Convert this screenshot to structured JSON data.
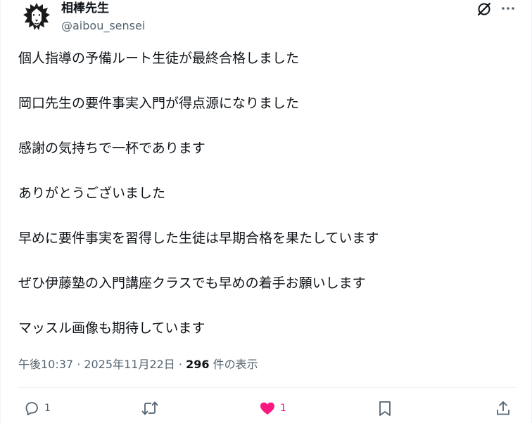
{
  "author": {
    "display_name": "相棒先生",
    "handle": "@aibou_sensei"
  },
  "tweet": {
    "lines": [
      "個人指導の予備ルート生徒が最終合格しました",
      "岡口先生の要件事実入門が得点源になりました",
      "感謝の気持ちで一杯であります",
      "ありがとうございました",
      "早めに要件事実を習得した生徒は早期合格を果たしています",
      "ぜひ伊藤塾の入門講座クラスでも早めの着手お願いします",
      "マッスル画像も期待しています"
    ],
    "timestamp": "午後10:37 · 2025年11月22日 · ",
    "views_count": "296",
    "views_label": " 件の表示"
  },
  "actions": {
    "reply_count": "1",
    "like_count": "1"
  },
  "icons": {
    "avatar": "lion-avatar-icon",
    "grok": "grok-icon",
    "more": "more-icon",
    "reply": "reply-icon",
    "retweet": "retweet-icon",
    "like": "heart-icon",
    "bookmark": "bookmark-icon",
    "share": "share-icon"
  },
  "colors": {
    "text": "#0f1419",
    "secondary": "#536471",
    "like": "#f91880",
    "divider": "#eff3f4"
  }
}
